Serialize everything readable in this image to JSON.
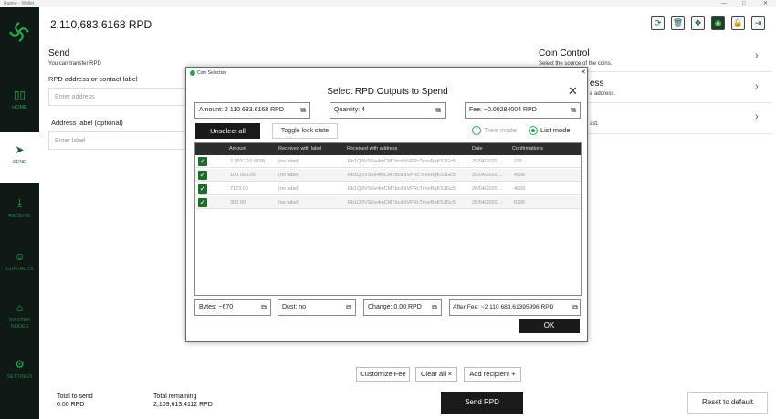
{
  "window": {
    "app_title": "Raptor - Wallet",
    "min": "—",
    "max": "□",
    "close": "✕"
  },
  "header": {
    "balance": "2,110,683.6168 RPD"
  },
  "toolbar": {
    "icons": [
      "refresh-icon",
      "trash-icon",
      "shield-icon",
      "wifi-icon",
      "lock-icon",
      "export-icon"
    ]
  },
  "sidebar": {
    "items": [
      {
        "label": "HOME",
        "icon": "home-icon"
      },
      {
        "label": "SEND",
        "icon": "send-icon"
      },
      {
        "label": "RECEIVE",
        "icon": "receive-icon"
      },
      {
        "label": "CONTACTS",
        "icon": "contacts-icon"
      },
      {
        "label": "MASTER NODES",
        "icon": "masternodes-icon"
      },
      {
        "label": "SETTINGS",
        "icon": "settings-icon"
      }
    ]
  },
  "send": {
    "title": "Send",
    "subtitle": "You can transfer RPD",
    "address_label": "RPD address or contact label",
    "address_placeholder": "Enter address",
    "label_label": "Address label (optional)",
    "label_placeholder": "Enter label"
  },
  "coin_control": {
    "title": "Coin Control",
    "subtitle": "Select the source of the coins.",
    "item2_title": "ess",
    "item2_sub": "e address.",
    "item3_sub": "ast."
  },
  "footer": {
    "customize_fee": "Customize Fee",
    "clear_all": "Clear all ×",
    "add_recipient": "Add recipient +",
    "total_to_send_label": "Total to send",
    "total_to_send_value": "0.00 RPD",
    "total_remaining_label": "Total remaining",
    "total_remaining_value": "2,109,613.4112 RPD",
    "send_button": "Send RPD",
    "reset_button": "Reset to default"
  },
  "dialog": {
    "window_title": "Coin Selection",
    "heading": "Select RPD Outputs to Spend",
    "amount": "Amount: 2 110 683.6168 RPD",
    "quantity": "Quantity: 4",
    "fee": "Fee: ~0.00284004 RPD",
    "unselect_all": "Unselect all",
    "toggle_lock": "Toggle lock state",
    "tree_mode": "Tree mode",
    "list_mode": "List mode",
    "columns": [
      "Amount",
      "Received with label",
      "Received with address",
      "Date",
      "Confirmations"
    ],
    "rows": [
      {
        "amount": "2 003 210.6168",
        "label": "(no label)",
        "address": "Rb1QBVSKe4mCMTbcdNVPRcTnsvRgKS1Gc5",
        "date": "29/04/2020 ...",
        "confirmations": "275"
      },
      {
        "amount": "100 000.00",
        "label": "(no label)",
        "address": "Rb1QBVSKe4mCMTbcdNVPRcTnsvRgKS1Gc5",
        "date": "26/04/2020 ...",
        "confirmations": "4956"
      },
      {
        "amount": "7173.00",
        "label": "(no label)",
        "address": "Rb1QBVSKe4mCMTbcdNVPRcTnsvRgKS1Gc5",
        "date": "26/04/2020 ...",
        "confirmations": "4959"
      },
      {
        "amount": "300.00",
        "label": "(no label)",
        "address": "Rb1QBVSKe4mCMTbcdNVPRcTnsvRgKS1Gc5",
        "date": "25/04/2020 ...",
        "confirmations": "6296"
      }
    ],
    "bytes": "Bytes: ~670",
    "dust": "Dust: no",
    "change": "Change: 0.00 RPD",
    "after_fee": "After Fee: ~2 110 683.61395996 RPD",
    "ok": "OK"
  },
  "colors": {
    "accent_green": "#2aa54d",
    "sidebar_bg": "#0f1a17",
    "dark_button": "#1a1a1a"
  }
}
